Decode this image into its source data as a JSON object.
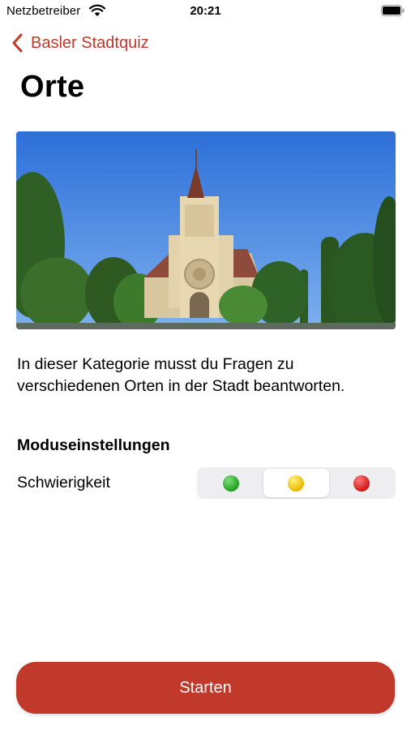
{
  "status_bar": {
    "carrier": "Netzbetreiber",
    "time": "20:21",
    "wifi_icon": "wifi-icon",
    "battery_icon": "battery-full-icon"
  },
  "nav": {
    "back_label": "Basler Stadtquiz",
    "back_icon": "chevron-left-icon"
  },
  "page": {
    "title": "Orte",
    "hero_image": "church-photo",
    "description": "In dieser Kategorie musst du Fragen zu verschiedenen Orten in der Stadt beantworten."
  },
  "settings": {
    "section_title": "Moduseinstellungen",
    "difficulty_label": "Schwierigkeit",
    "difficulty_options": [
      {
        "name": "easy",
        "color": "#2eb82e"
      },
      {
        "name": "medium",
        "color": "#f2c40f"
      },
      {
        "name": "hard",
        "color": "#e02626"
      }
    ],
    "selected_difficulty_index": 1
  },
  "start_button": {
    "label": "Starten"
  },
  "colors": {
    "accent": "#c0392b",
    "segment_bg": "#eeeef0"
  }
}
